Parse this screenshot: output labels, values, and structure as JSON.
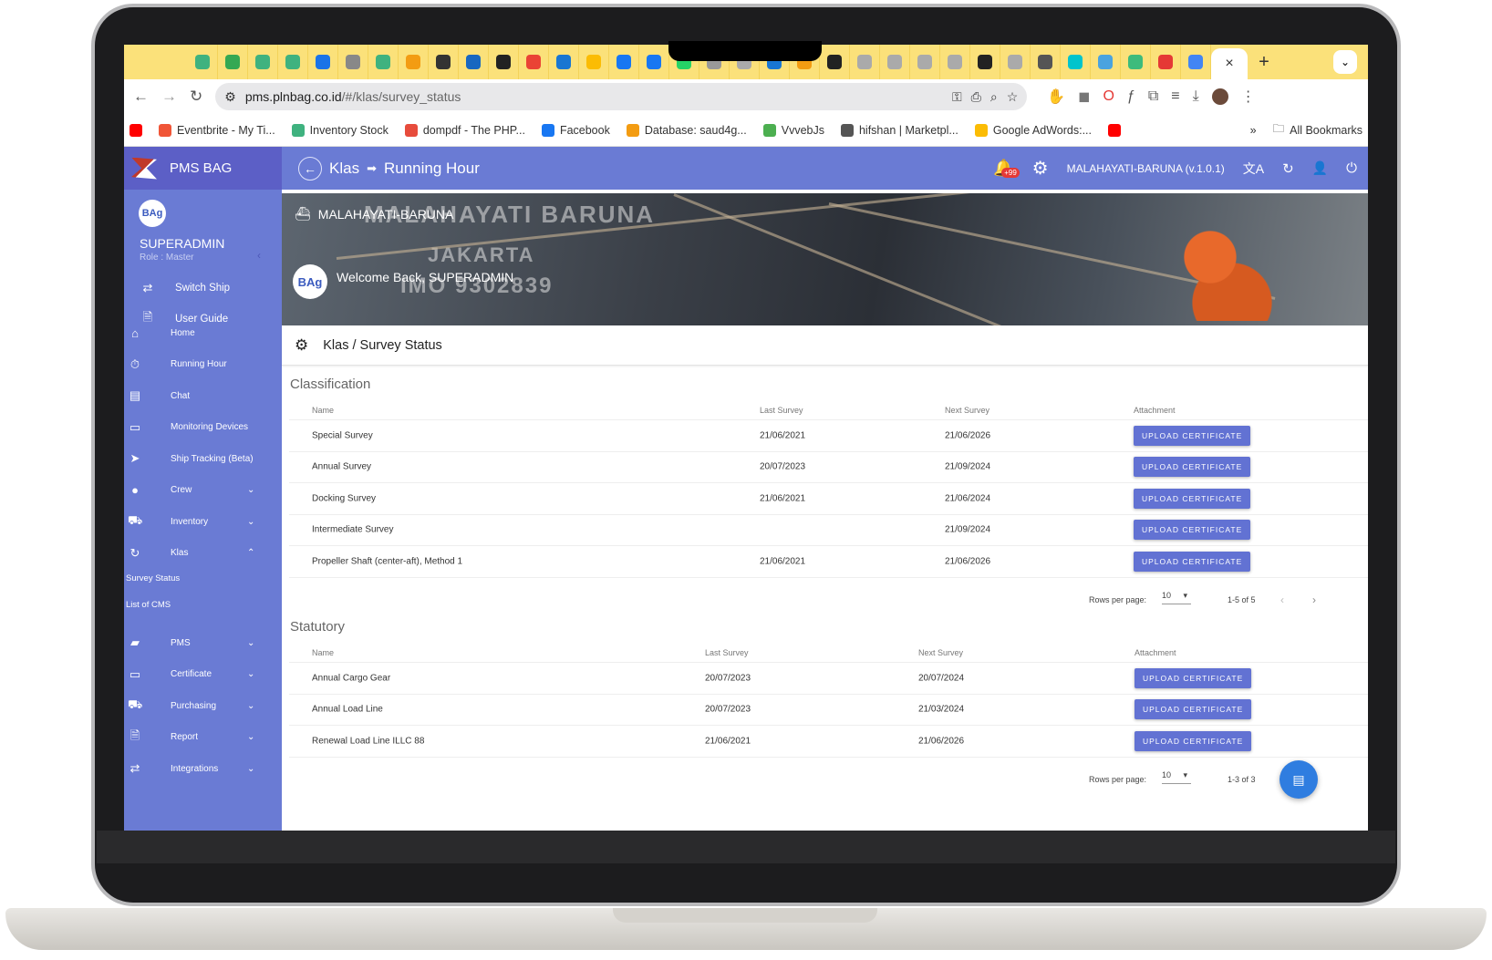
{
  "browser": {
    "tab_favicons": [
      {
        "icon": "vue-icon",
        "color": "#3fb27f"
      },
      {
        "icon": "sheets-icon",
        "color": "#34a853"
      },
      {
        "icon": "vue-icon",
        "color": "#3fb27f"
      },
      {
        "icon": "vue-icon",
        "color": "#3fb27f"
      },
      {
        "icon": "bootstrap-icon",
        "color": "#1a73e8"
      },
      {
        "icon": "openai-icon",
        "color": "#888"
      },
      {
        "icon": "vue-icon",
        "color": "#3fb27f"
      },
      {
        "icon": "pma-icon",
        "color": "#f39c12"
      },
      {
        "icon": "audio-icon",
        "color": "#333"
      },
      {
        "icon": "vuetify-icon",
        "color": "#1867c0"
      },
      {
        "icon": "openai-icon",
        "color": "#222"
      },
      {
        "icon": "gmail-icon",
        "color": "#ea4335"
      },
      {
        "icon": "app-icon",
        "color": "#1976d2"
      },
      {
        "icon": "adwords-icon",
        "color": "#fbbc04"
      },
      {
        "icon": "facebook-icon",
        "color": "#1877f2"
      },
      {
        "icon": "facebook-icon",
        "color": "#1877f2"
      },
      {
        "icon": "whatsapp-icon",
        "color": "#25d366"
      },
      {
        "icon": "globe-icon",
        "color": "#999"
      },
      {
        "icon": "elephant-icon",
        "color": "#aaa"
      },
      {
        "icon": "app-icon",
        "color": "#1976d2"
      },
      {
        "icon": "pma-icon",
        "color": "#f39c12"
      },
      {
        "icon": "openai-icon",
        "color": "#222"
      },
      {
        "icon": "elephant-icon",
        "color": "#aaa"
      },
      {
        "icon": "elephant-icon",
        "color": "#aaa"
      },
      {
        "icon": "elephant-icon",
        "color": "#aaa"
      },
      {
        "icon": "elephant-icon",
        "color": "#aaa"
      },
      {
        "icon": "openai-icon",
        "color": "#222"
      },
      {
        "icon": "elephant-icon",
        "color": "#aaa"
      },
      {
        "icon": "panda-icon",
        "color": "#555"
      },
      {
        "icon": "canva-icon",
        "color": "#00c4cc"
      },
      {
        "icon": "bird-icon",
        "color": "#4aa3df"
      },
      {
        "icon": "app-icon",
        "color": "#3dbb7c"
      },
      {
        "icon": "opera-icon",
        "color": "#e53935"
      },
      {
        "icon": "forms-icon",
        "color": "#4285f4"
      }
    ],
    "active_tab_close": "×",
    "new_tab": "+",
    "tab_menu": "⌄",
    "url_host": "pms.plnbag.co.id",
    "url_path": "/#/klas/survey_status",
    "bookmarks": [
      {
        "label": "",
        "color": "#ff0000"
      },
      {
        "label": "Eventbrite - My Ti...",
        "color": "#f05537"
      },
      {
        "label": "Inventory Stock",
        "color": "#3fb27f"
      },
      {
        "label": "dompdf - The PHP...",
        "color": "#e74c3c"
      },
      {
        "label": "Facebook",
        "color": "#1877f2"
      },
      {
        "label": "Database: saud4g...",
        "color": "#f39c12"
      },
      {
        "label": "VvvebJs",
        "color": "#4caf50"
      },
      {
        "label": "hifshan | Marketpl...",
        "color": "#555"
      },
      {
        "label": "Google AdWords:...",
        "color": "#fbbc04"
      },
      {
        "label": "",
        "color": "#ff0000"
      }
    ],
    "more_bookmarks": "»",
    "all_bookmarks": "All Bookmarks"
  },
  "app": {
    "brand": "PMS BAG",
    "user": {
      "avatar_text": "BAg",
      "name": "SUPERADMIN",
      "role": "Role : Master"
    },
    "sidebar": {
      "top_items": [
        {
          "label": "Switch Ship",
          "icon": "swap-icon",
          "glyph": "⇄"
        },
        {
          "label": "User Guide",
          "icon": "document-icon",
          "glyph": "🗎"
        }
      ],
      "items": [
        {
          "label": "Home",
          "icon": "home-icon",
          "glyph": "⌂",
          "chevron": ""
        },
        {
          "label": "Running Hour",
          "icon": "timer-icon",
          "glyph": "⏱",
          "chevron": ""
        },
        {
          "label": "Chat",
          "icon": "chat-icon",
          "glyph": "▤",
          "chevron": ""
        },
        {
          "label": "Monitoring Devices",
          "icon": "devices-icon",
          "glyph": "▭",
          "chevron": ""
        },
        {
          "label": "Ship Tracking (Beta)",
          "icon": "navigation-icon",
          "glyph": "➤",
          "chevron": ""
        },
        {
          "label": "Crew",
          "icon": "person-icon",
          "glyph": "●",
          "chevron": "⌄"
        },
        {
          "label": "Inventory",
          "icon": "cart-icon",
          "glyph": "⛟",
          "chevron": "⌄"
        },
        {
          "label": "Klas",
          "icon": "refresh-icon",
          "glyph": "↻",
          "chevron": "⌃"
        }
      ],
      "klas_sub": [
        "Survey Status",
        "List of CMS"
      ],
      "items_after": [
        {
          "label": "PMS",
          "icon": "briefcase-icon",
          "glyph": "▰",
          "chevron": "⌄"
        },
        {
          "label": "Certificate",
          "icon": "monitor-icon",
          "glyph": "▭",
          "chevron": "⌄"
        },
        {
          "label": "Purchasing",
          "icon": "cart-icon",
          "glyph": "⛟",
          "chevron": "⌄"
        },
        {
          "label": "Report",
          "icon": "report-icon",
          "glyph": "🗎",
          "chevron": "⌄"
        },
        {
          "label": "Integrations",
          "icon": "swap-icon",
          "glyph": "⇄",
          "chevron": "⌄"
        }
      ]
    },
    "header": {
      "crumb_parent": "Klas",
      "crumb_current": "Running Hour",
      "notification_badge": "+99",
      "ship_version": "MALAHAYATI-BARUNA (v.1.0.1)"
    },
    "banner": {
      "ship_name": "MALAHAYATI-BARUNA",
      "avatar_text": "BAg",
      "welcome": "Welcome Back, SUPERADMIN",
      "photo_text": [
        "MALAHAYATI BARUNA",
        "JAKARTA",
        "IMO 9302839"
      ]
    },
    "page_title": "Klas / Survey Status",
    "classification": {
      "title": "Classification",
      "columns": [
        "Name",
        "Last Survey",
        "Next Survey",
        "Attachment"
      ],
      "rows": [
        {
          "name": "Special Survey",
          "last": "21/06/2021",
          "next": "21/06/2026",
          "action": "UPLOAD CERTIFICATE"
        },
        {
          "name": "Annual Survey",
          "last": "20/07/2023",
          "next": "21/09/2024",
          "action": "UPLOAD CERTIFICATE"
        },
        {
          "name": "Docking Survey",
          "last": "21/06/2021",
          "next": "21/06/2024",
          "action": "UPLOAD CERTIFICATE"
        },
        {
          "name": "Intermediate Survey",
          "last": "",
          "next": "21/09/2024",
          "action": "UPLOAD CERTIFICATE"
        },
        {
          "name": "Propeller Shaft (center-aft), Method 1",
          "last": "21/06/2021",
          "next": "21/06/2026",
          "action": "UPLOAD CERTIFICATE"
        }
      ],
      "rows_per_page_label": "Rows per page:",
      "rows_per_page": "10",
      "range": "1-5 of 5"
    },
    "statutory": {
      "title": "Statutory",
      "columns": [
        "Name",
        "Last Survey",
        "Next Survey",
        "Attachment"
      ],
      "rows": [
        {
          "name": "Annual Cargo Gear",
          "last": "20/07/2023",
          "next": "20/07/2024",
          "action": "UPLOAD CERTIFICATE"
        },
        {
          "name": "Annual Load Line",
          "last": "20/07/2023",
          "next": "21/03/2024",
          "action": "UPLOAD CERTIFICATE"
        },
        {
          "name": "Renewal Load Line ILLC 88",
          "last": "21/06/2021",
          "next": "21/06/2026",
          "action": "UPLOAD CERTIFICATE"
        }
      ],
      "rows_per_page_label": "Rows per page:",
      "rows_per_page": "10",
      "range": "1-3 of 3"
    },
    "colors": {
      "primary": "#6a7bd4",
      "brand_bar": "#5c5fc6",
      "button": "#6272d3",
      "tab_strip": "#fbe17a",
      "fab": "#2f7de0",
      "badge": "#e53935"
    }
  }
}
